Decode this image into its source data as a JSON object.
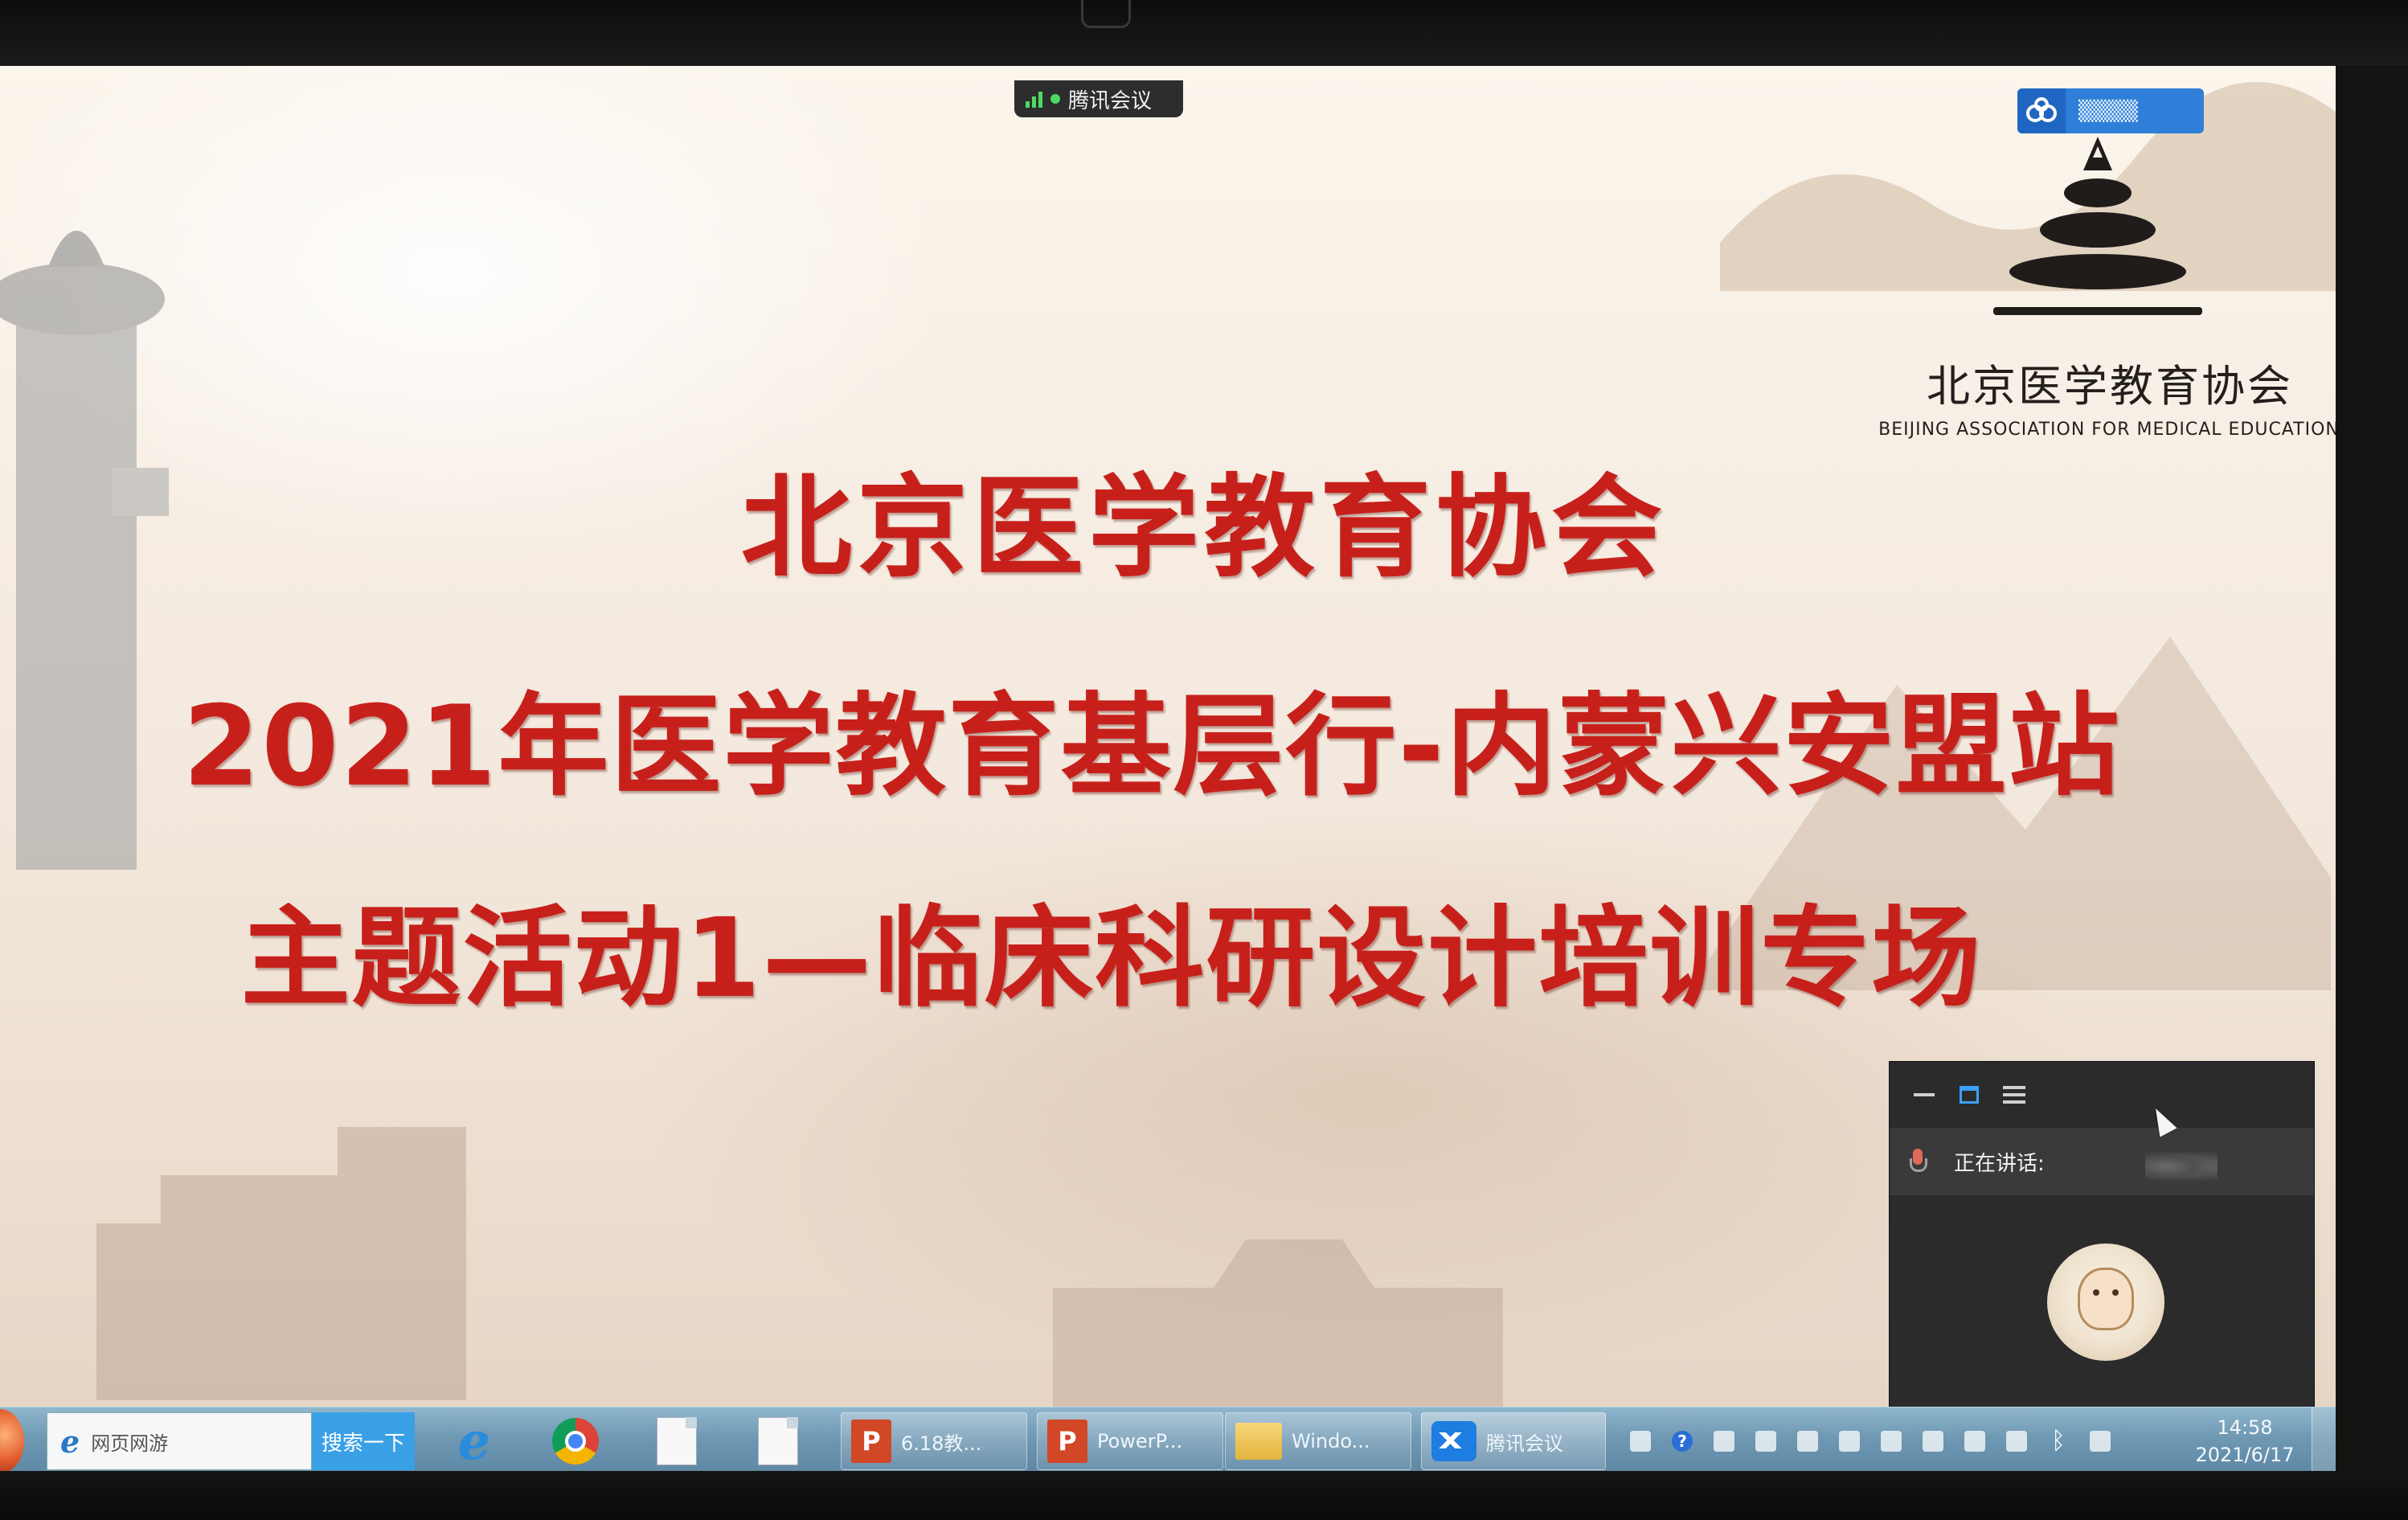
{
  "meeting_indicator": {
    "label": "腾讯会议"
  },
  "slide": {
    "title_line_1": "北京医学教育协会",
    "title_line_2": "2021年医学教育基层行-内蒙兴安盟站",
    "title_line_3": "主题活动1—临床科研设计培训专场",
    "logo": {
      "name_cn": "北京医学教育协会",
      "name_en": "BEIJING ASSOCIATION FOR MEDICAL EDUCATION"
    }
  },
  "speaker_panel": {
    "speaking_label": "正在讲话:"
  },
  "taskbar": {
    "search_placeholder": "网页网游",
    "search_button": "搜索一下",
    "tasks": [
      {
        "label": "6.18教...",
        "icon": "powerpoint-icon"
      },
      {
        "label": "PowerP...",
        "icon": "powerpoint-icon"
      },
      {
        "label": "Windo...",
        "icon": "folder-icon"
      },
      {
        "label": "腾讯会议",
        "icon": "tencent-meeting-icon"
      }
    ],
    "clock": {
      "time": "14:58",
      "date": "2021/6/17"
    }
  },
  "colors": {
    "title_red": "#c7201b",
    "taskbar_blue": "#6f98b3",
    "meeting_blue": "#1d7de0"
  }
}
